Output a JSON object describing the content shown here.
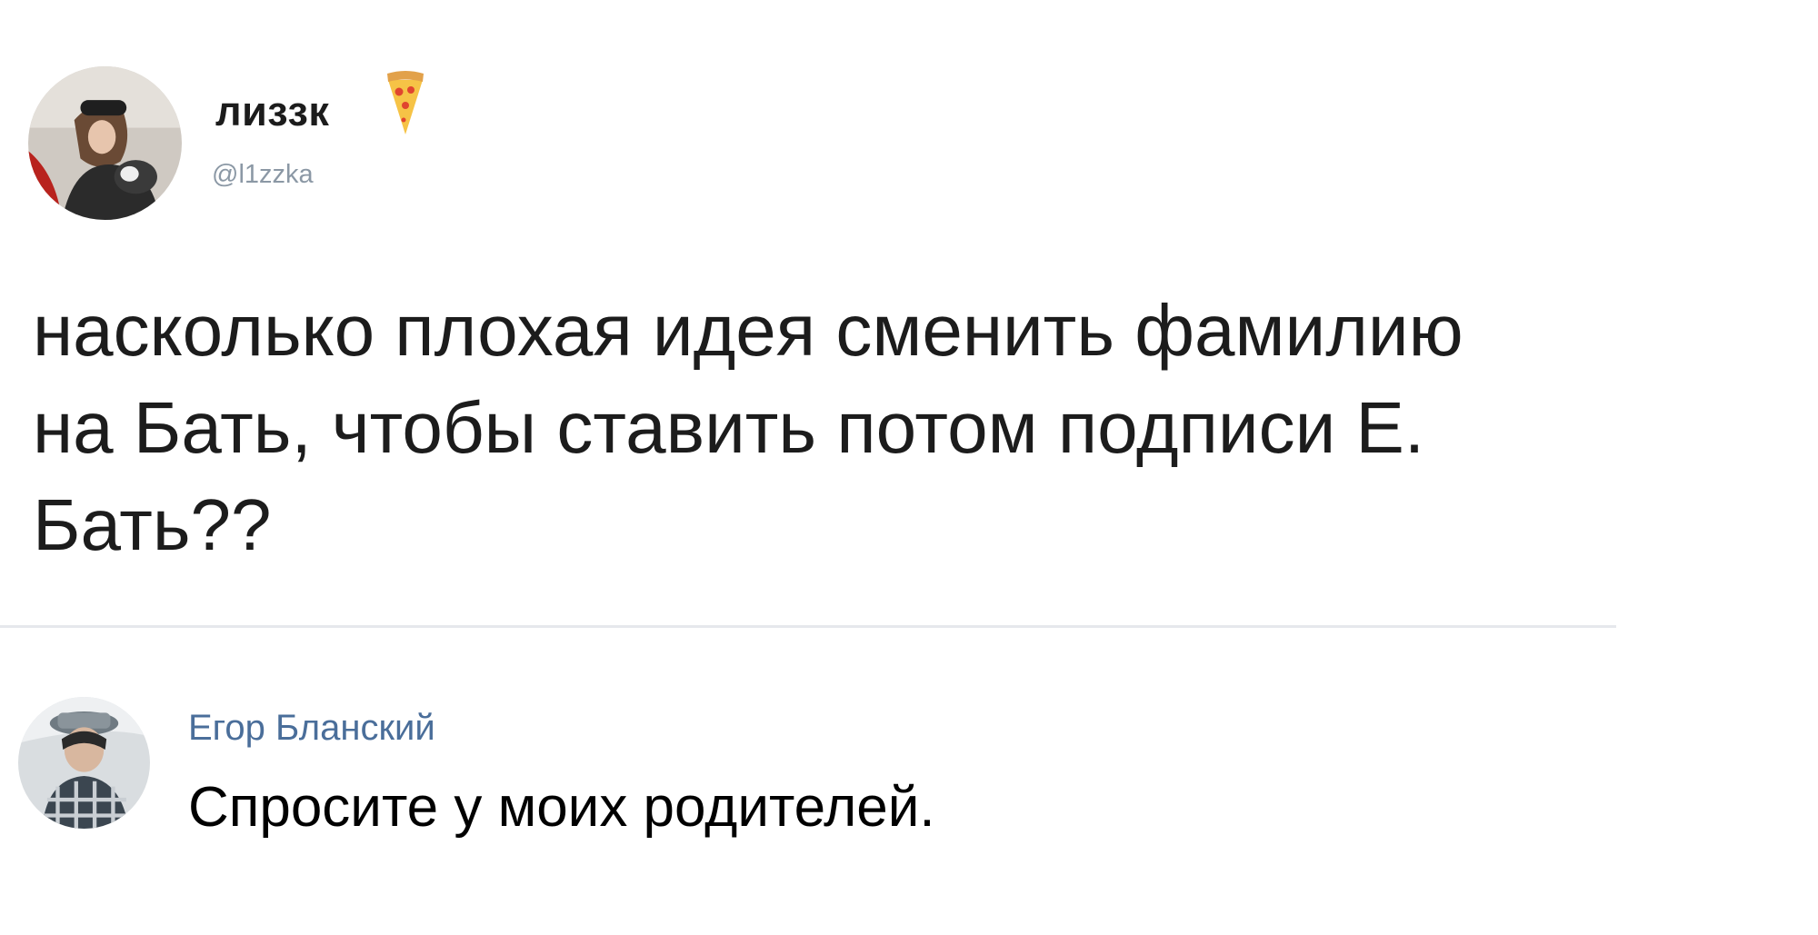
{
  "tweet": {
    "author": {
      "display_name": "лиззк",
      "handle": "@l1zzka",
      "emoji_icon": "pizza-icon",
      "avatar_icon": "user-avatar"
    },
    "text_lines": [
      "насколько плохая идея сменить фамилию",
      "на Бать, чтобы ставить потом подписи Е.",
      "Бать??"
    ]
  },
  "comment": {
    "author": {
      "display_name": "Егор Бланский",
      "avatar_icon": "user-avatar"
    },
    "text": "Спросите у моих родителей."
  },
  "colors": {
    "text_primary": "#1c1c1c",
    "handle": "#8b98a5",
    "divider": "#e6e8ec",
    "commenter_name": "#4a6e9a"
  }
}
